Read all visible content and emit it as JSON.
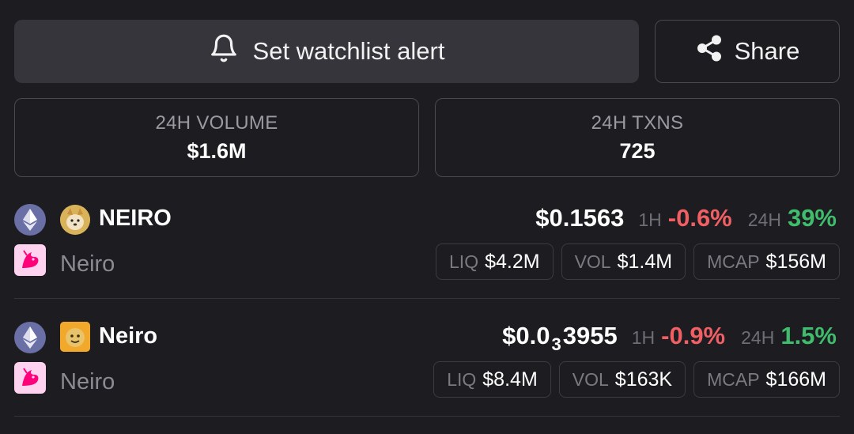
{
  "actions": {
    "alert_label": "Set watchlist alert",
    "alert_icon": "bell-icon",
    "share_label": "Share",
    "share_icon": "share-icon"
  },
  "stats": {
    "volume_label": "24H VOLUME",
    "volume_value": "$1.6M",
    "txns_label": "24H TXNS",
    "txns_value": "725"
  },
  "pairs": [
    {
      "chain_icon": "ethereum-icon",
      "dex_icon": "uniswap-icon",
      "symbol": "NEIRO",
      "name": "Neiro",
      "price": "$0.1563",
      "h1_label": "1H",
      "h1_change": "-0.6%",
      "h24_label": "24H",
      "h24_change": "39%",
      "liq_label": "LIQ",
      "liq_value": "$4.2M",
      "vol_label": "VOL",
      "vol_value": "$1.4M",
      "mcap_label": "MCAP",
      "mcap_value": "$156M"
    },
    {
      "chain_icon": "ethereum-icon",
      "dex_icon": "uniswap-icon",
      "symbol": "Neiro",
      "name": "Neiro",
      "price_prefix": "$0.0",
      "price_zeros": "3",
      "price_suffix": "3955",
      "h1_label": "1H",
      "h1_change": "-0.9%",
      "h24_label": "24H",
      "h24_change": "1.5%",
      "liq_label": "LIQ",
      "liq_value": "$8.4M",
      "vol_label": "VOL",
      "vol_value": "$163K",
      "mcap_label": "MCAP",
      "mcap_value": "$166M"
    }
  ],
  "colors": {
    "background": "#1d1c21",
    "negative": "#ef5f63",
    "positive": "#3fbd6c",
    "ethereum": "#6a6fa5",
    "uniswap": "#ff007a"
  }
}
